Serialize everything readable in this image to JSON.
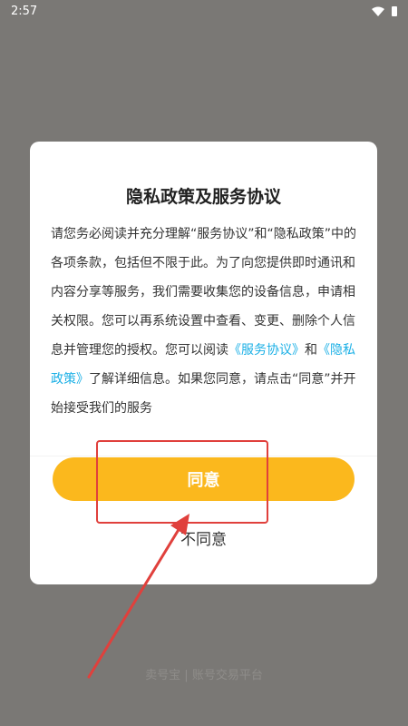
{
  "status_bar": {
    "time": "2:57",
    "icons": [
      "wifi-icon",
      "battery-icon"
    ]
  },
  "dialog": {
    "title": "隐私政策及服务协议",
    "body": {
      "part1": "请您务必阅读并充分理解“服务协议”和“隐私政策”中的各项条款，包括但不限于此。为了向您提供即时通讯和内容分享等服务，我们需要收集您的设备信息，申请相关权限。您可以再系统设置中查看、变更、删除个人信息并管理您的授权。您可以阅读",
      "link_service": "《服务协议》",
      "and": "和",
      "link_privacy": "《隐私政策》",
      "part2": "了解详细信息。如果您同意，请点击“同意”并开始接受我们的服务"
    },
    "agree_label": "同意",
    "disagree_label": "不同意"
  },
  "footer": {
    "brand": "卖号宝 | 账号交易平台"
  },
  "colors": {
    "accent": "#fbb81d",
    "link": "#1cb0e6",
    "annotation": "#e0403c",
    "overlay": "#7a7875"
  }
}
